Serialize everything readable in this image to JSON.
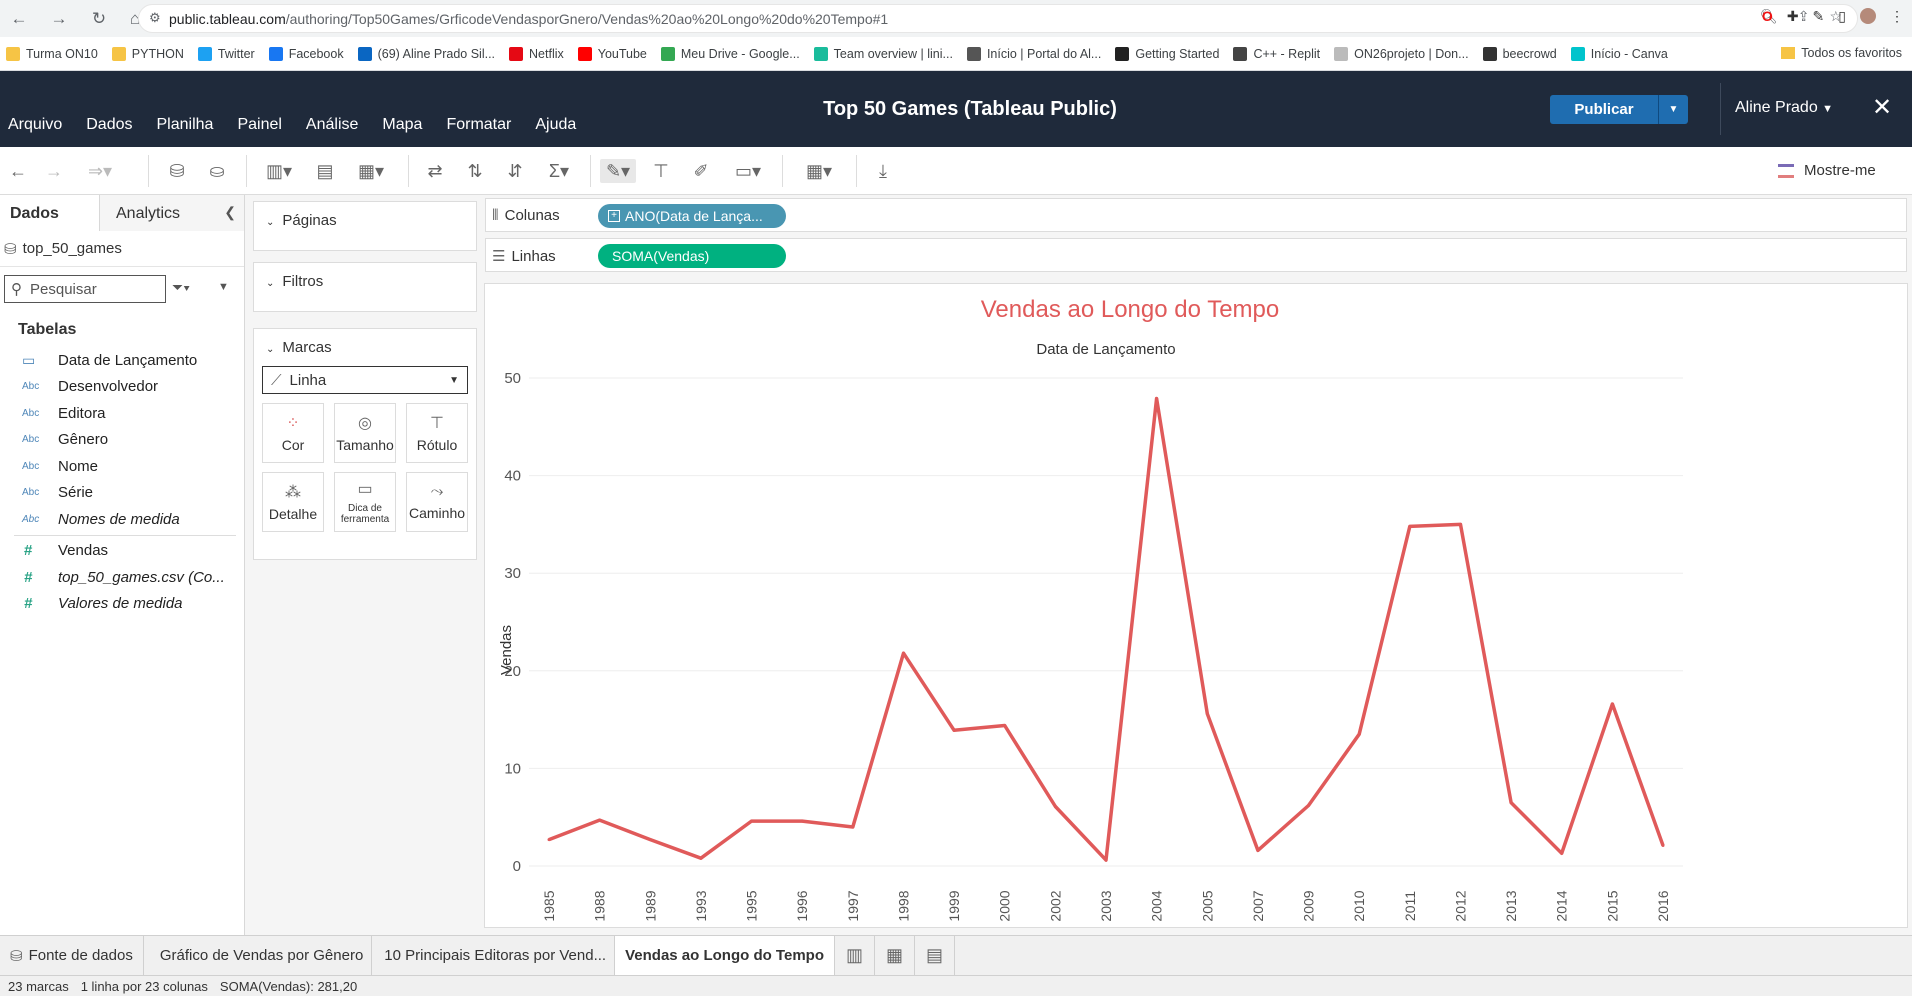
{
  "browser": {
    "url_host": "public.tableau.com",
    "url_path": "/authoring/Top50Games/GrficodeVendasporGnero/Vendas%20ao%20Longo%20do%20Tempo#1",
    "bookmarks": [
      "Turma ON10",
      "PYTHON",
      "Twitter",
      "Facebook",
      "(69) Aline Prado Sil...",
      "Netflix",
      "YouTube",
      "Meu Drive - Google...",
      "Team overview | lini...",
      "Início | Portal do Al...",
      "Getting Started",
      "C++ - Replit",
      "ON26projeto | Don...",
      "beecrowd",
      "Início - Canva"
    ],
    "bookmarks_right": "Todos os favoritos"
  },
  "app": {
    "menu": [
      "Arquivo",
      "Dados",
      "Planilha",
      "Painel",
      "Análise",
      "Mapa",
      "Formatar",
      "Ajuda"
    ],
    "title": "Top 50 Games (Tableau Public)",
    "publish": "Publicar",
    "user": "Aline Prado"
  },
  "toolbar": {
    "show_me": "Mostre-me"
  },
  "data_panel": {
    "tab_data": "Dados",
    "tab_analytics": "Analytics",
    "datasource": "top_50_games",
    "search_placeholder": "Pesquisar",
    "tables_label": "Tabelas",
    "dimensions": [
      {
        "icon": "calendar",
        "name": "Data de Lançamento"
      },
      {
        "icon": "Abc",
        "name": "Desenvolvedor"
      },
      {
        "icon": "Abc",
        "name": "Editora"
      },
      {
        "icon": "Abc",
        "name": "Gênero"
      },
      {
        "icon": "Abc",
        "name": "Nome"
      },
      {
        "icon": "Abc",
        "name": "Série"
      },
      {
        "icon": "Abc",
        "name": "Nomes de medida"
      }
    ],
    "measures": [
      {
        "icon": "#",
        "name": "Vendas"
      },
      {
        "icon": "#",
        "name": "top_50_games.csv (Co..."
      },
      {
        "icon": "#",
        "name": "Valores de medida"
      }
    ]
  },
  "cards": {
    "pages": "Páginas",
    "filters": "Filtros",
    "marks": "Marcas",
    "mark_type": "Linha",
    "buttons": [
      "Cor",
      "Tamanho",
      "Rótulo",
      "Detalhe",
      "Dica de ferramenta",
      "Caminho"
    ]
  },
  "shelves": {
    "columns_label": "Colunas",
    "columns_pill": "ANO(Data de Lança...",
    "rows_label": "Linhas",
    "rows_pill": "SOMA(Vendas)"
  },
  "colors": {
    "line": "#e05a5a",
    "pill_dim": "#4996b2",
    "pill_measure": "#00b180",
    "topbar": "#1f2a3b"
  },
  "chart_data": {
    "type": "line",
    "title": "Vendas ao Longo do Tempo",
    "xlabel": "Data de Lançamento",
    "ylabel": "Vendas",
    "ylim": [
      0,
      50
    ],
    "yticks": [
      0,
      10,
      20,
      30,
      40,
      50
    ],
    "categories": [
      "1985",
      "1988",
      "1989",
      "1993",
      "1995",
      "1996",
      "1997",
      "1998",
      "1999",
      "2000",
      "2002",
      "2003",
      "2004",
      "2005",
      "2007",
      "2009",
      "2010",
      "2011",
      "2012",
      "2013",
      "2014",
      "2015",
      "2016"
    ],
    "series": [
      {
        "values": [
          2.7,
          4.7,
          2.7,
          0.8,
          4.6,
          4.6,
          4.0,
          21.8,
          13.9,
          14.4,
          6.1,
          0.6,
          47.9,
          15.6,
          1.6,
          6.2,
          13.5,
          34.8,
          35.0,
          6.5,
          1.3,
          16.6,
          2.1
        ]
      }
    ]
  },
  "sheets": {
    "datasource_tab": "Fonte de dados",
    "tabs": [
      "Gráfico de Vendas por Gênero",
      "10 Principais Editoras por Vend...",
      "Vendas ao Longo do Tempo"
    ]
  },
  "status": {
    "marks": "23 marcas",
    "dims": "1 linha por 23 colunas",
    "sum": "SOMA(Vendas): 281,20"
  }
}
